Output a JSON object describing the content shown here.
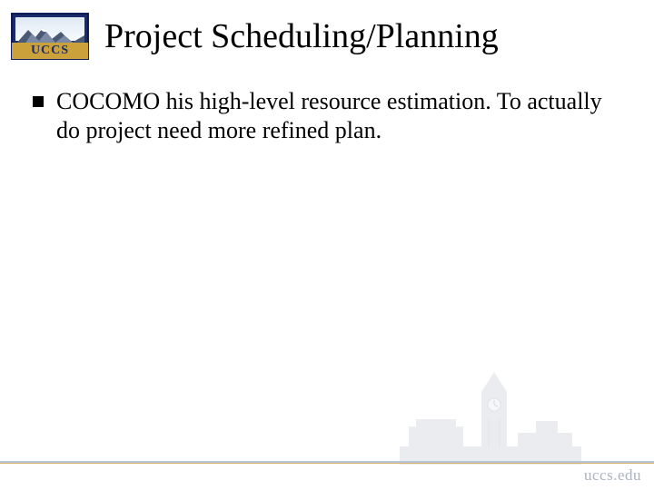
{
  "logo": {
    "text": "UCCS"
  },
  "title": "Project Scheduling/Planning",
  "bullets": [
    "COCOMO his high-level resource estimation. To actually do project need more refined plan."
  ],
  "footer": {
    "domain": "uccs.edu"
  }
}
